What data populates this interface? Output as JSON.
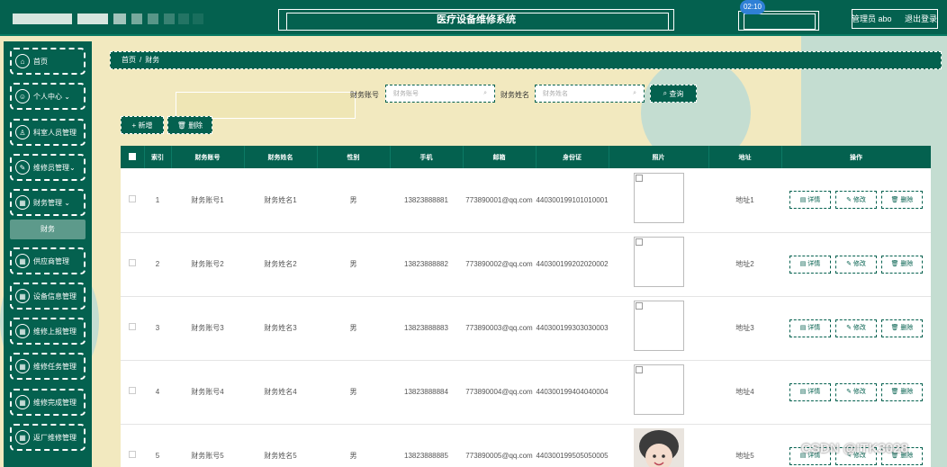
{
  "header": {
    "title": "医疗设备维修系统",
    "time_badge": "02:10",
    "user": "管理员 abo",
    "logout": "退出登录"
  },
  "sidebar": {
    "items": [
      {
        "label": "首页",
        "icon": "home-icon"
      },
      {
        "label": "个人中心",
        "icon": "user-icon"
      },
      {
        "label": "科室人员管理",
        "icon": "person-icon"
      },
      {
        "label": "维修员管理",
        "icon": "wrench-icon"
      },
      {
        "label": "财务管理",
        "icon": "grid-icon"
      },
      {
        "label": "供应商管理",
        "icon": "grid-icon"
      },
      {
        "label": "设备信息管理",
        "icon": "grid-icon"
      },
      {
        "label": "维修上报管理",
        "icon": "grid-icon"
      },
      {
        "label": "维修任务管理",
        "icon": "grid-icon"
      },
      {
        "label": "维修完成管理",
        "icon": "grid-icon"
      },
      {
        "label": "返厂维修管理",
        "icon": "grid-icon"
      }
    ],
    "active_sub": "财务"
  },
  "breadcrumb": {
    "home": "首页",
    "sep": "/",
    "current": "财务"
  },
  "search": {
    "account_label": "财务账号",
    "account_placeholder": "财务账号",
    "name_label": "财务姓名",
    "name_placeholder": "财务姓名",
    "button": "查询"
  },
  "toolbar": {
    "add": "新增",
    "delete": "删除"
  },
  "table": {
    "headers": [
      "索引",
      "财务账号",
      "财务姓名",
      "性别",
      "手机",
      "邮箱",
      "身份证",
      "照片",
      "地址",
      "操作"
    ],
    "rows": [
      {
        "index": "1",
        "account": "财务账号1",
        "name": "财务姓名1",
        "gender": "男",
        "phone": "13823888881",
        "email": "773890001@qq.com",
        "idcard": "440300199101010001",
        "address": "地址1"
      },
      {
        "index": "2",
        "account": "财务账号2",
        "name": "财务姓名2",
        "gender": "男",
        "phone": "13823888882",
        "email": "773890002@qq.com",
        "idcard": "440300199202020002",
        "address": "地址2"
      },
      {
        "index": "3",
        "account": "财务账号3",
        "name": "财务姓名3",
        "gender": "男",
        "phone": "13823888883",
        "email": "773890003@qq.com",
        "idcard": "440300199303030003",
        "address": "地址3"
      },
      {
        "index": "4",
        "account": "财务账号4",
        "name": "财务姓名4",
        "gender": "男",
        "phone": "13823888884",
        "email": "773890004@qq.com",
        "idcard": "440300199404040004",
        "address": "地址4"
      },
      {
        "index": "5",
        "account": "财务账号5",
        "name": "财务姓名5",
        "gender": "男",
        "phone": "13823888885",
        "email": "773890005@qq.com",
        "idcard": "440300199505050005",
        "address": "地址5"
      }
    ],
    "ops": {
      "detail": "详情",
      "edit": "修改",
      "delete": "删除"
    }
  },
  "watermark": "CSDN @ITK3028",
  "colors": {
    "primary": "#04614f",
    "mint": "#c4ddd1",
    "cream": "#f2e9bf"
  }
}
